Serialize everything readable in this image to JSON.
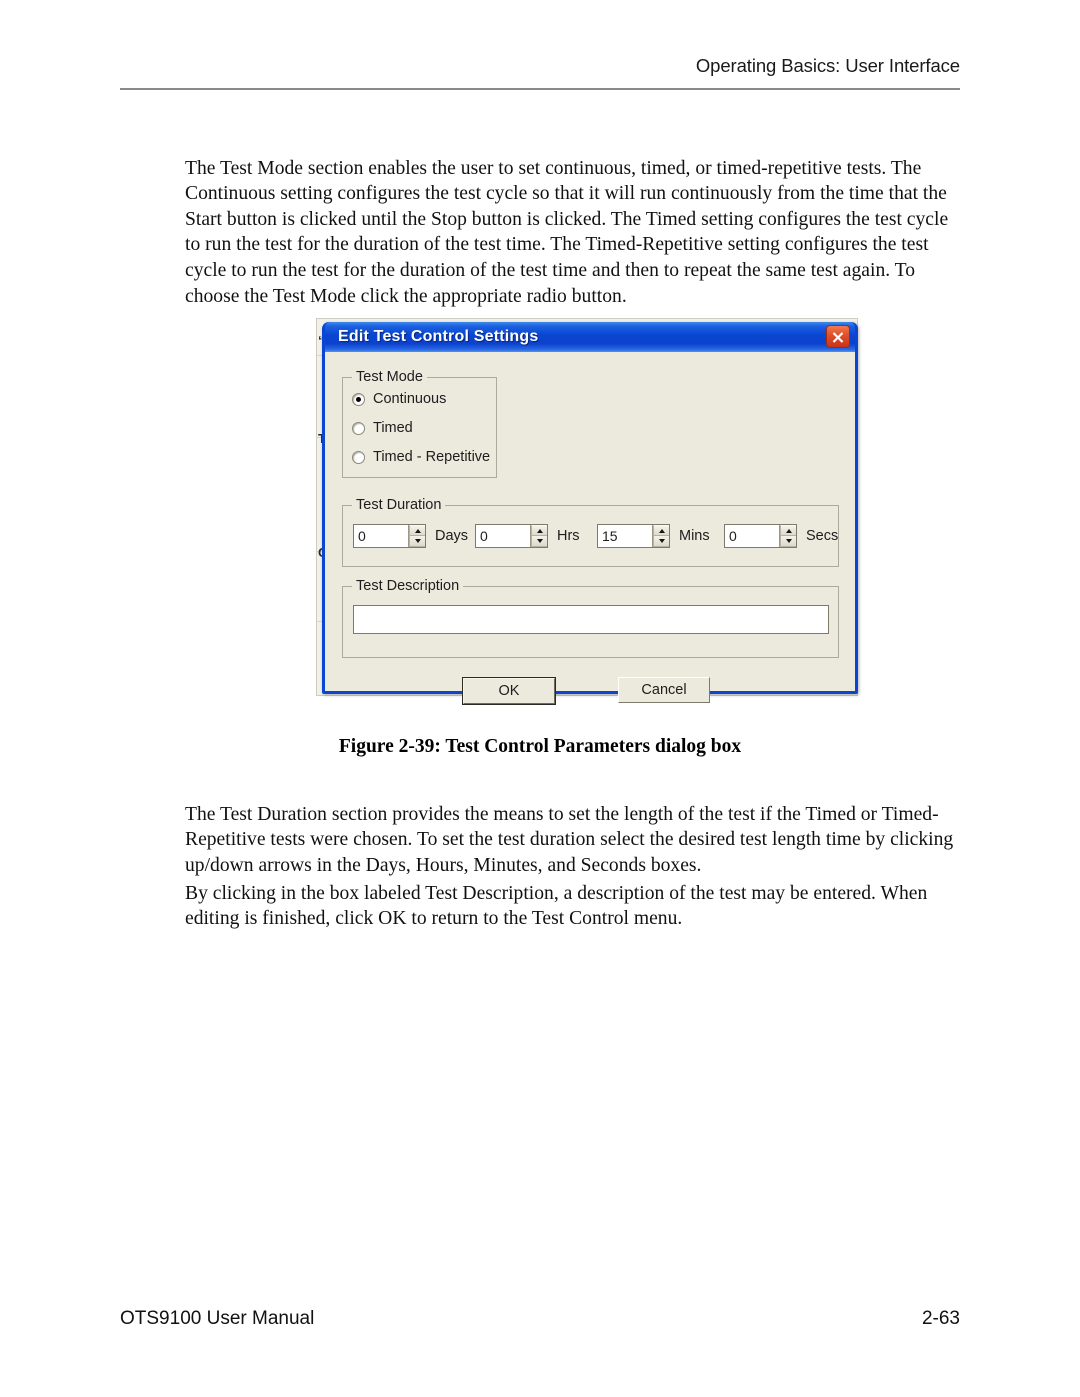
{
  "page": {
    "header": "Operating Basics: User Interface",
    "footer_left": "OTS9100 User Manual",
    "footer_right": "2-63"
  },
  "paragraphs": {
    "intro": "The Test Mode section enables the user to set continuous, timed, or timed-repetitive tests.  The Continuous setting configures the test cycle so that it will run continuously from the time that the Start button is clicked until the Stop button is clicked.  The Timed setting configures the test cycle to run the test for the duration of the test time.  The Timed-Repetitive setting configures the test cycle to run the test for the duration of the test time and then to repeat the same test again. To choose the Test Mode click the appropriate radio button.",
    "duration": "The Test Duration section provides the means to set the length of the test if the Timed or Timed-Repetitive tests were chosen.  To set the test duration select the desired test length time by clicking up/down arrows in the Days, Hours, Minutes, and Seconds boxes.",
    "description": "By clicking in the box labeled Test Description, a description of the test may be entered.  When editing is finished, click OK to return to the Test Control menu."
  },
  "figure": {
    "caption": "Figure 2-39: Test Control Parameters dialog box"
  },
  "dialog": {
    "title": "Edit Test Control Settings",
    "close_icon": "close-icon",
    "test_mode": {
      "group_label": "Test Mode",
      "selected": "Continuous",
      "options": [
        {
          "label": "Continuous",
          "checked": true
        },
        {
          "label": "Timed",
          "checked": false
        },
        {
          "label": "Timed - Repetitive",
          "checked": false
        }
      ]
    },
    "test_duration": {
      "group_label": "Test Duration",
      "fields": [
        {
          "value": "0",
          "unit": "Days"
        },
        {
          "value": "0",
          "unit": "Hrs"
        },
        {
          "value": "15",
          "unit": "Mins"
        },
        {
          "value": "0",
          "unit": "Secs"
        }
      ]
    },
    "test_description": {
      "group_label": "Test Description",
      "value": ""
    },
    "buttons": {
      "ok": "OK",
      "cancel": "Cancel"
    },
    "colors": {
      "titlebar_blue": "#0a46d2",
      "close_red": "#c6331a",
      "dialog_face": "#ece9dd",
      "frame_blue": "#0a46d2"
    }
  }
}
